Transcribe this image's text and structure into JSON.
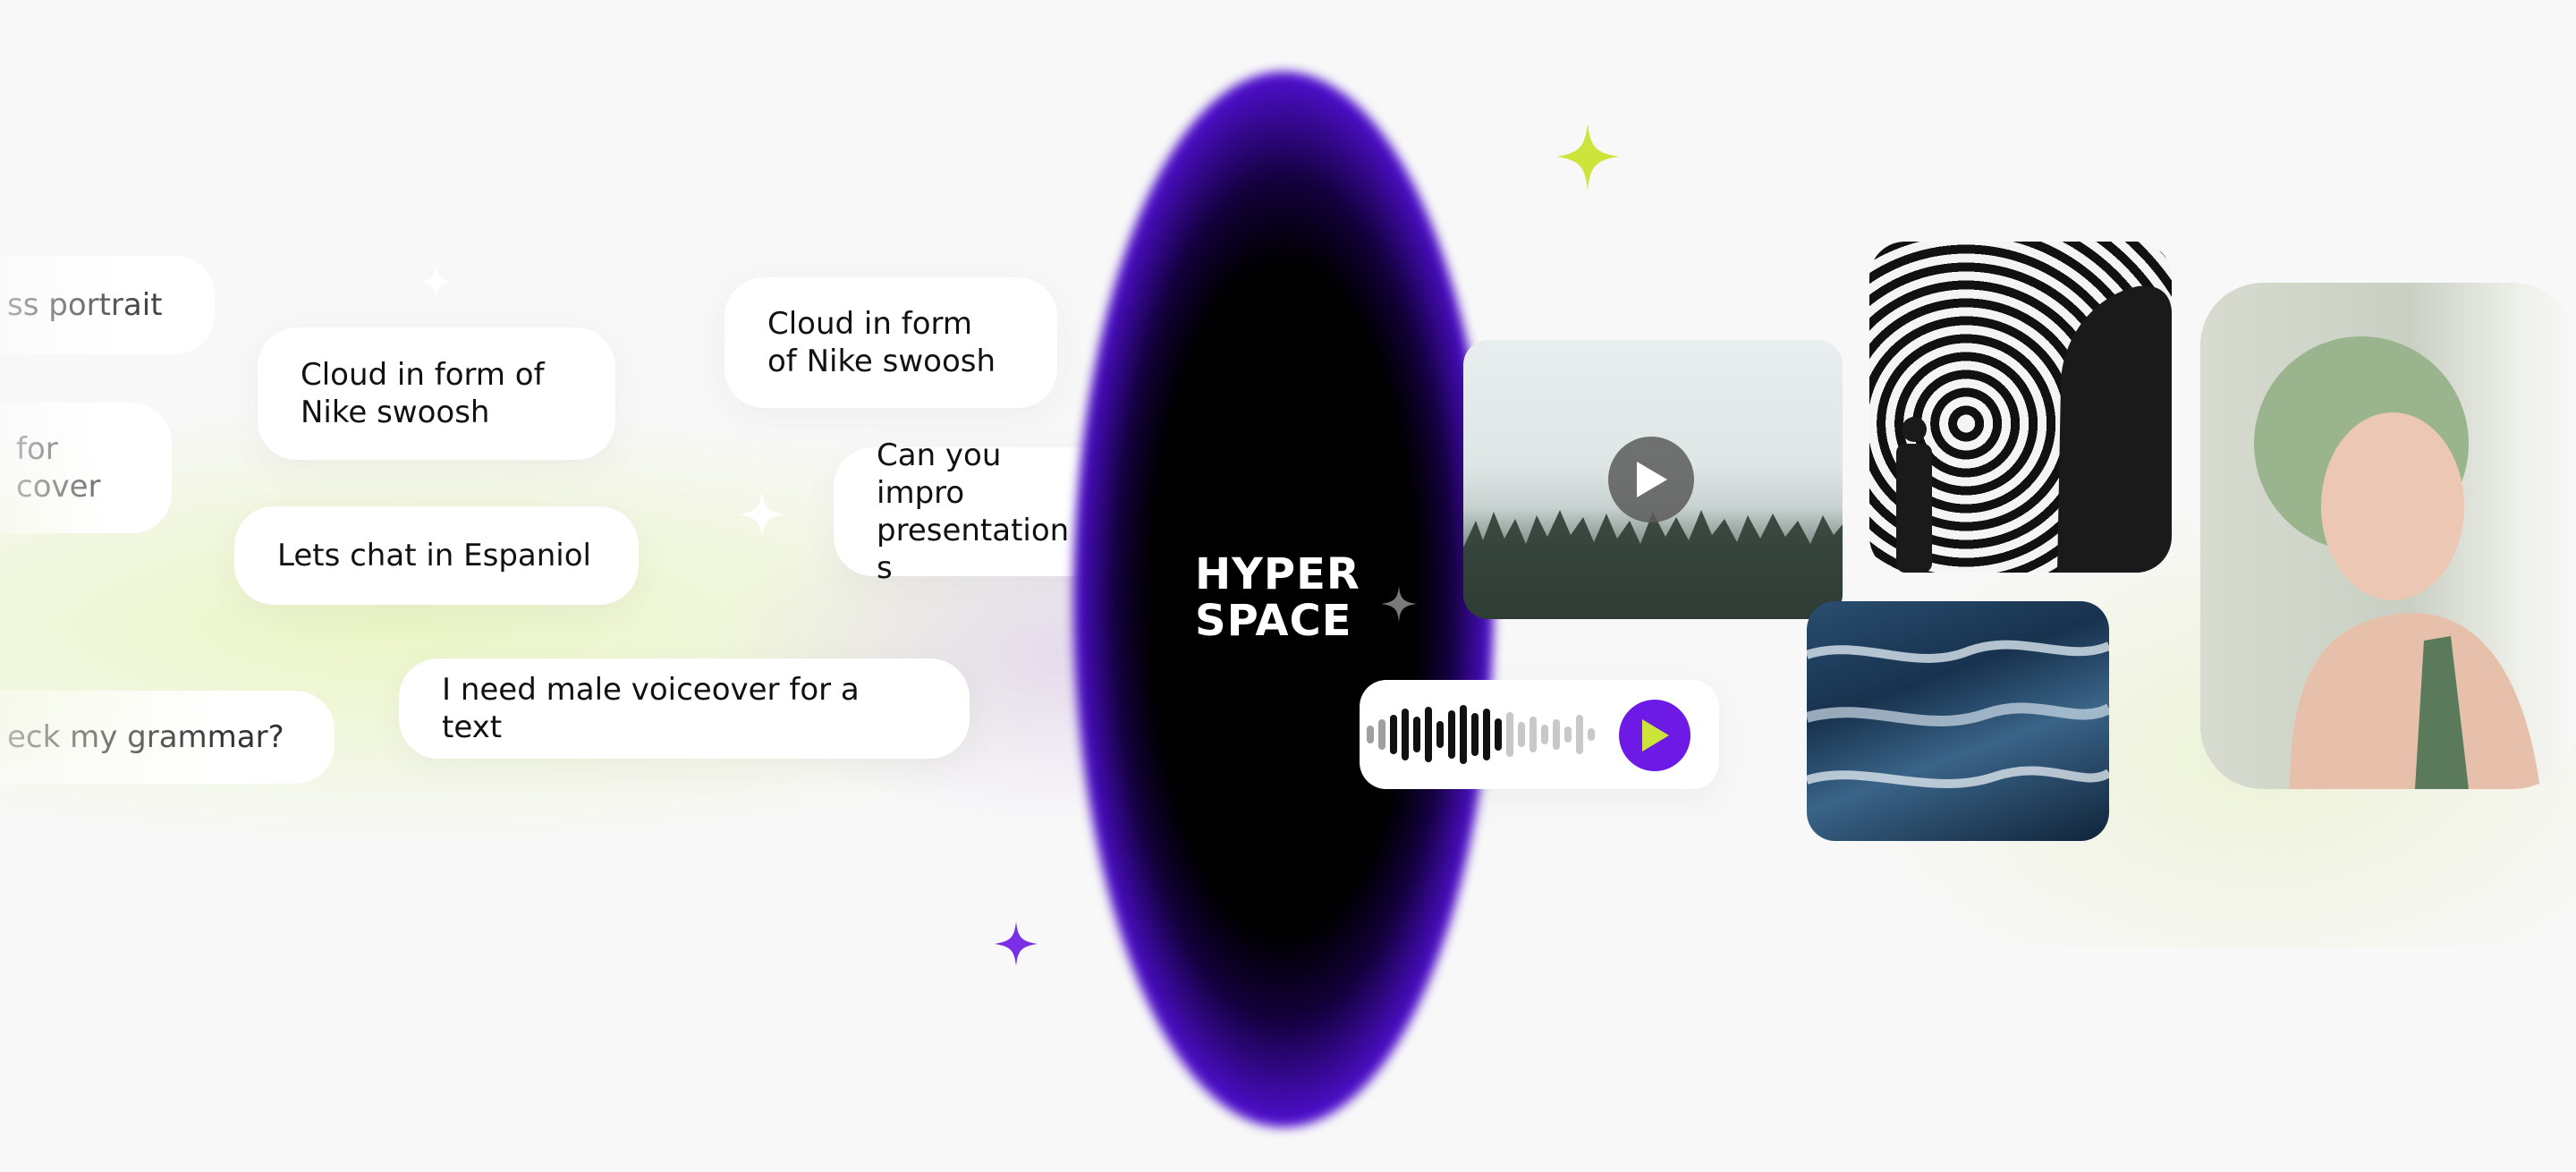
{
  "logo": {
    "line1": "HYPER",
    "line2": "SPACE"
  },
  "colors": {
    "accent_purple": "#6d1ae6",
    "accent_lime": "#cde43a",
    "portal_black": "#000000",
    "bubble_bg": "#ffffff",
    "page_bg": "#f8f8f8"
  },
  "prompts": [
    {
      "text": "ss portrait"
    },
    {
      "text": "Cloud in form of\nNike swoosh"
    },
    {
      "text": "for\ncover"
    },
    {
      "text": "Lets chat in Espaniol"
    },
    {
      "text": "eck my grammar?"
    },
    {
      "text": "Cloud in form\nof Nike swoosh"
    },
    {
      "text": "Can you impro\npresentation s"
    },
    {
      "text": "I need male voiceover for a text"
    }
  ],
  "media": {
    "video_card": {
      "icon": "play-icon"
    },
    "audio_card": {
      "icon": "play-icon",
      "wave_bars": 20
    },
    "images": [
      "hypnotic-spiral-image",
      "ocean-painting-image",
      "green-haired-woman-portrait-image"
    ]
  },
  "sparkles": [
    "sparkle-lime-icon",
    "sparkle-purple-icon",
    "sparkle-white-icon",
    "sparkle-white-small-icon",
    "sparkle-grey-icon"
  ]
}
